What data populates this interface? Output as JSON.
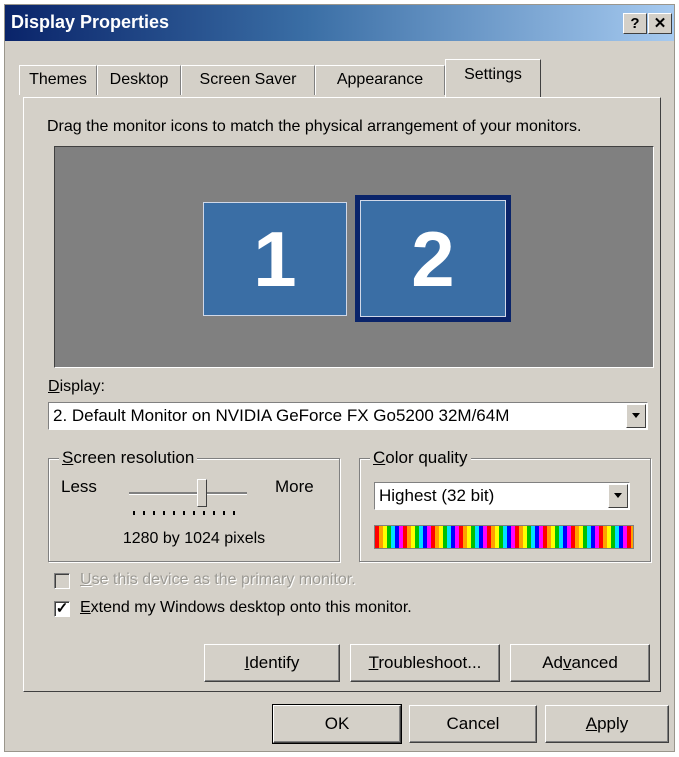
{
  "window": {
    "title": "Display Properties",
    "help_label": "?",
    "close_label": "✕"
  },
  "tabs": [
    {
      "label": "Themes"
    },
    {
      "label": "Desktop"
    },
    {
      "label": "Screen Saver"
    },
    {
      "label": "Appearance"
    },
    {
      "label": "Settings",
      "active": true
    }
  ],
  "settings": {
    "instruction": "Drag the monitor icons to match the physical arrangement of your monitors.",
    "monitors": [
      {
        "label": "1"
      },
      {
        "label": "2",
        "selected": true
      }
    ],
    "display_label": "Display:",
    "display_value": "2. Default Monitor on NVIDIA GeForce FX Go5200 32M/64M",
    "resolution": {
      "legend": "Screen resolution",
      "less": "Less",
      "more": "More",
      "value_text": "1280 by 1024 pixels",
      "slider_level_fraction": 0.62
    },
    "color_quality": {
      "legend": "Color quality",
      "value": "Highest (32 bit)"
    },
    "primary_checkbox": {
      "label": "Use this device as the primary monitor.",
      "checked": false,
      "disabled": true
    },
    "extend_checkbox": {
      "label": "Extend my Windows desktop onto this monitor.",
      "checked": true
    },
    "buttons": {
      "identify": "Identify",
      "troubleshoot": "Troubleshoot...",
      "advanced": "Advanced"
    }
  },
  "footer": {
    "ok": "OK",
    "cancel": "Cancel",
    "apply": "Apply"
  },
  "colors": {
    "titlebar_start": "#0a246a",
    "titlebar_end": "#a6caf0",
    "monitor_fill": "#3a6ea5",
    "desktop_area": "#808080"
  }
}
